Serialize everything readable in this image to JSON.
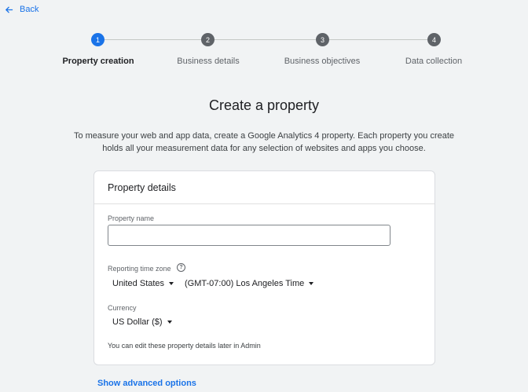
{
  "nav": {
    "back_label": "Back"
  },
  "stepper": {
    "steps": [
      {
        "number": "1",
        "label": "Property creation"
      },
      {
        "number": "2",
        "label": "Business details"
      },
      {
        "number": "3",
        "label": "Business objectives"
      },
      {
        "number": "4",
        "label": "Data collection"
      }
    ],
    "active_step": 1
  },
  "page": {
    "title": "Create a property",
    "description": "To measure your web and app data, create a Google Analytics 4 property. Each property you create holds all your measurement data for any selection of websites and apps you choose."
  },
  "card": {
    "title": "Property details",
    "property_name": {
      "label": "Property name",
      "value": "",
      "placeholder": ""
    },
    "time_zone": {
      "label": "Reporting time zone",
      "country": "United States",
      "zone": "(GMT-07:00) Los Angeles Time"
    },
    "currency": {
      "label": "Currency",
      "value": "US Dollar ($)"
    },
    "note": "You can edit these property details later in Admin"
  },
  "advanced_link": "Show advanced options",
  "colors": {
    "accent": "#1a73e8",
    "inactive_step": "#5f6368",
    "background": "#f1f3f4"
  },
  "icons": {
    "back": "arrow-left-icon",
    "help": "help-circle-icon",
    "dropdown": "caret-down-icon"
  }
}
